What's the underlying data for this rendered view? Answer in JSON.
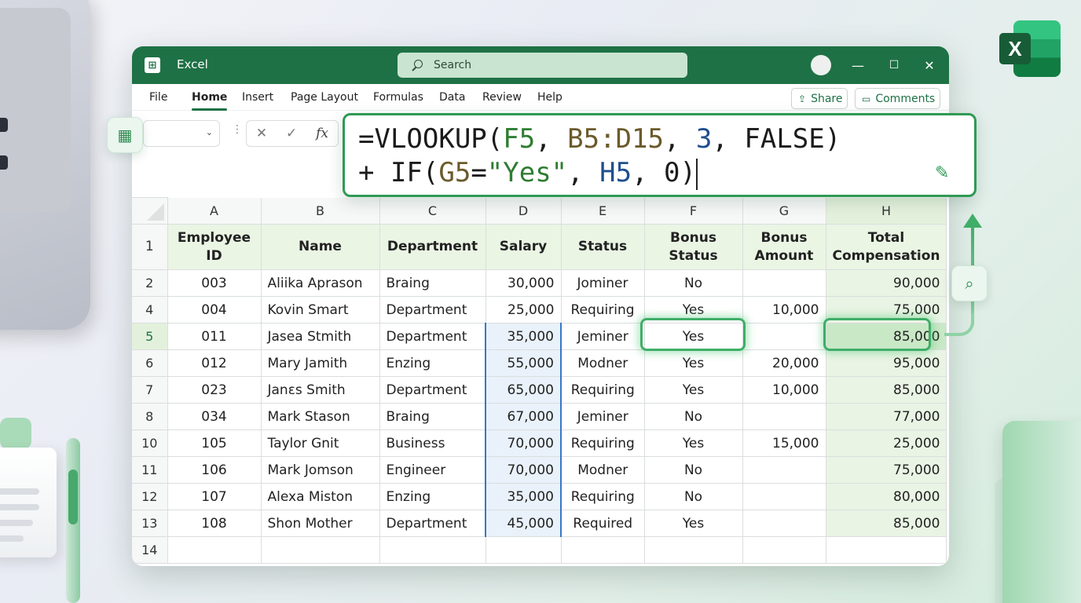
{
  "app": {
    "name": "Excel",
    "badge_letter": "X"
  },
  "search": {
    "placeholder": "Search"
  },
  "window_controls": {
    "minimize": "—",
    "maximize": "☐",
    "close": "✕"
  },
  "menu": [
    "File",
    "Home",
    "Insert",
    "Page Layout",
    "Formulas",
    "Data",
    "Review",
    "Help"
  ],
  "active_menu": "Home",
  "actions": {
    "share": "Share",
    "comments": "Comments"
  },
  "formula_bar": {
    "cancel": "✕",
    "enter": "✓",
    "fx": "fx"
  },
  "formula": {
    "line1": {
      "p1": "=VLOOKUP(",
      "a1": "F5",
      "s1": ", ",
      "a2": "B5:D15",
      "s2": ", ",
      "a3": "3",
      "s3": ", FALSE)"
    },
    "line2": {
      "p1": "+ IF(",
      "a1": "G5",
      "s1": "=",
      "a2": "\"Yes\"",
      "s2": ", ",
      "a3": "H5",
      "s3": ", 0)"
    }
  },
  "colors": {
    "accent": "#1e7145",
    "cell_ref_green": "#2e7d32",
    "cell_ref_olive": "#6b5a2a",
    "cell_ref_blue": "#1f4f8f",
    "string_green": "#2e7d32"
  },
  "columns": [
    "A",
    "B",
    "C",
    "D",
    "E",
    "F",
    "G",
    "H"
  ],
  "headers": [
    "Employee ID",
    "Name",
    "Department",
    "Salary",
    "Status",
    "Bonus Status",
    "Bonus Amount",
    "Total Compensation"
  ],
  "header_row": "1",
  "rows": [
    {
      "n": "2",
      "cells": [
        "003",
        "Aliika Aprason",
        "Braing",
        "30,000",
        "Jominer",
        "No",
        "",
        "90,000"
      ]
    },
    {
      "n": "4",
      "cells": [
        "004",
        "Kovin Smart",
        "Department",
        "25,000",
        "Requiring",
        "Yes",
        "10,000",
        "75,000"
      ]
    },
    {
      "n": "5",
      "cells": [
        "011",
        "Jasea Stmith",
        "Department",
        "35,000",
        "Jeminer",
        "Yes",
        "",
        "85,000"
      ]
    },
    {
      "n": "6",
      "cells": [
        "012",
        "Mary Jamith",
        "Enzing",
        "55,000",
        "Modner",
        "Yes",
        "20,000",
        "95,000"
      ]
    },
    {
      "n": "7",
      "cells": [
        "023",
        "Janεs Smith",
        "Department",
        "65,000",
        "Requiring",
        "Yes",
        "10,000",
        "85,000"
      ]
    },
    {
      "n": "8",
      "cells": [
        "034",
        "Mark Stason",
        "Braing",
        "67,000",
        "Jeminer",
        "No",
        "",
        "77,000"
      ]
    },
    {
      "n": "10",
      "cells": [
        "105",
        "Taylor Gnit",
        "Business",
        "70,000",
        "Requiring",
        "Yes",
        "15,000",
        "25,000"
      ]
    },
    {
      "n": "11",
      "cells": [
        "106",
        "Mark Jomson",
        "Engineer",
        "70,000",
        "Modner",
        "No",
        "",
        "75,000"
      ]
    },
    {
      "n": "12",
      "cells": [
        "107",
        "Alexa Miston",
        "Enzing",
        "35,000",
        "Requiring",
        "No",
        "",
        "80,000"
      ]
    },
    {
      "n": "13",
      "cells": [
        "108",
        "Shon Mother",
        "Department",
        "45,000",
        "Required",
        "Yes",
        "",
        "85,000"
      ]
    },
    {
      "n": "14",
      "cells": [
        "",
        "",
        "",
        "",
        "",
        "",
        "",
        ""
      ]
    }
  ]
}
